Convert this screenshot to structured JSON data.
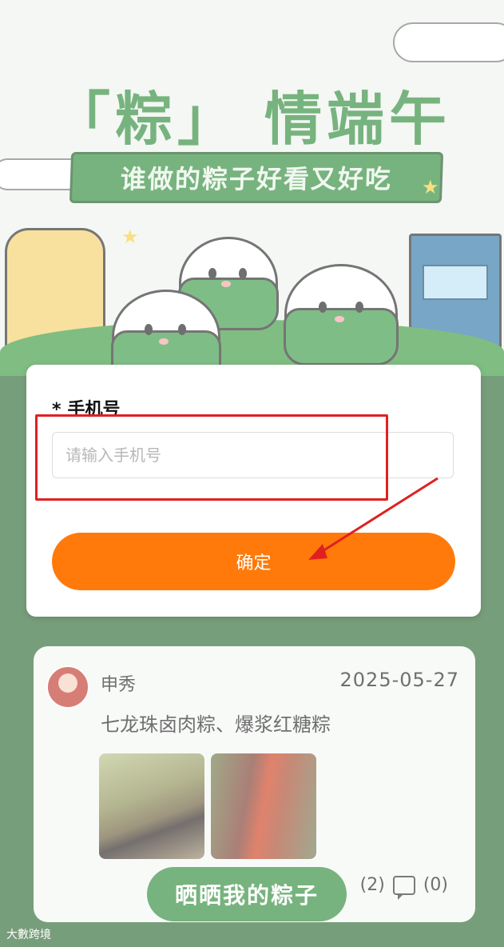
{
  "hero": {
    "title": "「粽」 情端午",
    "subtitle": "谁做的粽子好看又好吃"
  },
  "modal": {
    "asterisk": "*",
    "field_label": "手机号",
    "input_placeholder": "请输入手机号",
    "input_value": "",
    "confirm_label": "确定"
  },
  "post": {
    "username": "申秀",
    "date": "2025-05-27",
    "text": "七龙珠卤肉粽、爆浆红糖粽",
    "like_count": "(2)",
    "comment_count": "(0)"
  },
  "fab": {
    "label": "晒晒我的粽子"
  },
  "watermark": {
    "text": "大數跨境"
  },
  "colors": {
    "primary_green": "#2f8a3a",
    "accent_orange": "#ff7a0a",
    "annotation_red": "#e02020"
  }
}
